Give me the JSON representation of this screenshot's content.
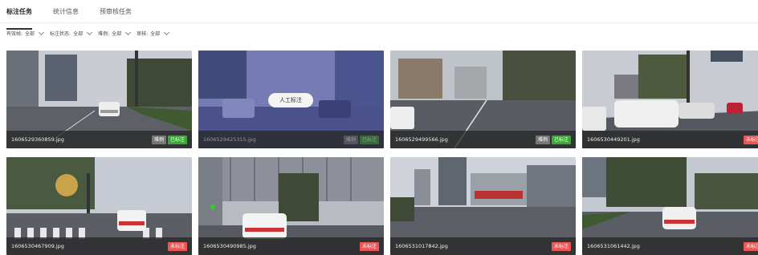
{
  "tabs": [
    {
      "label": "标注任务",
      "active": true
    },
    {
      "label": "统计信息",
      "active": false
    },
    {
      "label": "预审核任务",
      "active": false
    }
  ],
  "filters": [
    {
      "label": "有效帧:",
      "value": "全部"
    },
    {
      "label": "标注状态:",
      "value": "全部"
    },
    {
      "label": "难例:",
      "value": "全部"
    },
    {
      "label": "审核:",
      "value": "全部"
    }
  ],
  "cards": [
    {
      "filename": "1606529360859.jpg",
      "badges": [
        {
          "text": "难例",
          "kind": "gray"
        },
        {
          "text": "已标注",
          "kind": "green"
        }
      ]
    },
    {
      "filename": "1606529425315.jpg",
      "badges": [
        {
          "text": "难例",
          "kind": "gray"
        },
        {
          "text": "已标注",
          "kind": "green"
        }
      ],
      "hover_action": "人工标注"
    },
    {
      "filename": "1606529499566.jpg",
      "badges": [
        {
          "text": "难例",
          "kind": "gray"
        },
        {
          "text": "已标注",
          "kind": "green"
        }
      ]
    },
    {
      "filename": "1606530449201.jpg",
      "badges": [
        {
          "text": "未标注",
          "kind": "red"
        }
      ]
    },
    {
      "filename": "1606530467909.jpg",
      "badges": [
        {
          "text": "未标注",
          "kind": "red"
        }
      ]
    },
    {
      "filename": "1606530490985.jpg",
      "badges": [
        {
          "text": "未标注",
          "kind": "red"
        }
      ]
    },
    {
      "filename": "1606531017842.jpg",
      "badges": [
        {
          "text": "未标注",
          "kind": "red"
        }
      ]
    },
    {
      "filename": "1606531061442.jpg",
      "badges": [
        {
          "text": "未标注",
          "kind": "red"
        }
      ]
    }
  ],
  "colors": {
    "labeled": "#3aaa35",
    "unlabeled": "#ee5555",
    "hard": "#777777",
    "overlay": "#3c46aa"
  }
}
